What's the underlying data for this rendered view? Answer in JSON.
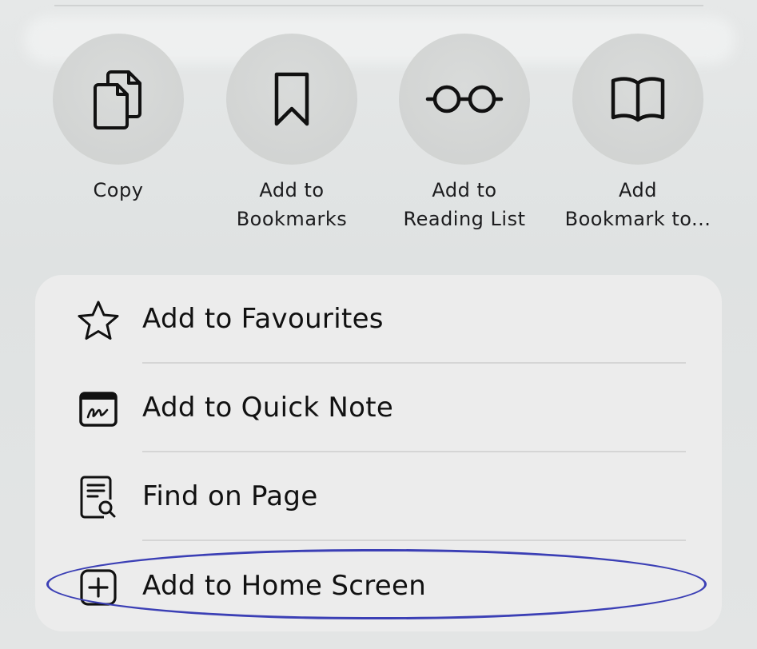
{
  "actions": [
    {
      "label_line1": "Copy",
      "label_line2": "",
      "icon": "copy-icon"
    },
    {
      "label_line1": "Add to",
      "label_line2": "Bookmarks",
      "icon": "bookmark-icon"
    },
    {
      "label_line1": "Add to",
      "label_line2": "Reading List",
      "icon": "glasses-icon"
    },
    {
      "label_line1": "Add",
      "label_line2": "Bookmark to...",
      "icon": "book-icon"
    }
  ],
  "menu": [
    {
      "label": "Add to Favourites",
      "icon": "star-icon"
    },
    {
      "label": "Add to Quick Note",
      "icon": "quick-note-icon"
    },
    {
      "label": "Find on Page",
      "icon": "find-on-page-icon"
    },
    {
      "label": "Add to Home Screen",
      "icon": "plus-square-icon"
    }
  ],
  "colors": {
    "highlight": "#3b3fb5",
    "menu_bg": "#ececec",
    "circle_bg": "#d3d5d4"
  }
}
